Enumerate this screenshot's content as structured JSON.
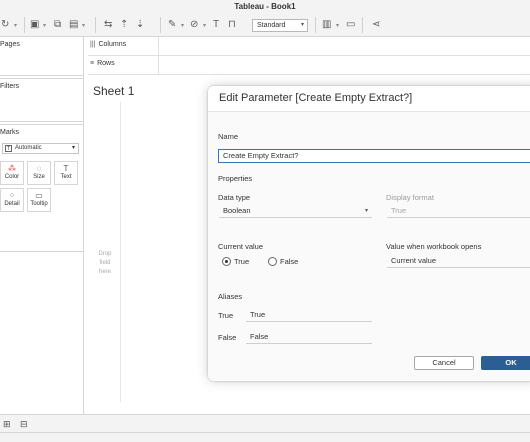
{
  "window": {
    "title": "Tableau - Book1"
  },
  "toolbar": {
    "fit_value": "Standard",
    "icons": [
      "refresh-icon",
      "new-datasource-icon",
      "new-worksheet-icon",
      "duplicate-icon",
      "swap-icon",
      "sort-ascending-icon",
      "sort-descending-icon",
      "highlight-icon",
      "group-icon",
      "label-icon",
      "fit-icon",
      "show-me-icon",
      "presentation-icon",
      "share-icon"
    ]
  },
  "left_panel": {
    "pages_title": "Pages",
    "filters_title": "Filters",
    "marks_title": "Marks",
    "marks_type": "Automatic",
    "mark_buttons": [
      {
        "label": "Color",
        "icon": "color-icon"
      },
      {
        "label": "Size",
        "icon": "size-icon"
      },
      {
        "label": "Text",
        "icon": "text-icon"
      },
      {
        "label": "Detail",
        "icon": "detail-icon"
      },
      {
        "label": "Tooltip",
        "icon": "tooltip-icon"
      }
    ]
  },
  "shelves": {
    "columns": "Columns",
    "rows": "Rows"
  },
  "sheet": {
    "title": "Sheet 1",
    "drop_field": [
      "Drop",
      "field",
      "here"
    ]
  },
  "dialog": {
    "title": "Edit Parameter [Create Empty Extract?]",
    "name_label": "Name",
    "name_value": "Create Empty Extract?",
    "properties_label": "Properties",
    "data_type_label": "Data type",
    "data_type_value": "Boolean",
    "display_format_label": "Display format",
    "display_format_value": "True",
    "current_value_label": "Current value",
    "current_value_options": [
      "True",
      "False"
    ],
    "current_value_selected": "True",
    "workbook_opens_label": "Value when workbook opens",
    "workbook_opens_value": "Current value",
    "aliases_label": "Aliases",
    "aliases": [
      {
        "value": "True",
        "alias": "True"
      },
      {
        "value": "False",
        "alias": "False"
      }
    ],
    "cancel_label": "Cancel",
    "ok_label": "OK"
  }
}
